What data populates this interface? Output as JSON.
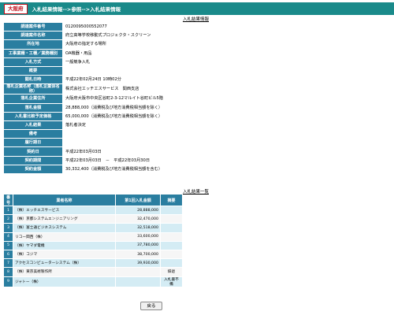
{
  "header": {
    "prefecture": "大阪府",
    "breadcrumb": "入札結果情報-->参照-->入札結果情報"
  },
  "details": {
    "caption": "入札結果情報",
    "rows": [
      {
        "label": "調達案件番号",
        "value": "0120095000552077"
      },
      {
        "label": "調達案件名称",
        "value": "府立高等学校移動式プロジェクタ・スクリーン"
      },
      {
        "label": "所在地",
        "value": "大阪府の指定する場所"
      },
      {
        "label": "工事業種・工種／業務種別",
        "value": "OA機器・用品"
      },
      {
        "label": "入札方式",
        "value": "一般競争入札"
      },
      {
        "label": "概要",
        "value": ""
      },
      {
        "label": "開札日時",
        "value": "平成22年02月24日 10時02分"
      },
      {
        "label": "落札企業名称（落札企業体名称）",
        "value": "株式会社エッチエスサービス　関西支店"
      },
      {
        "label": "落札企業住所",
        "value": "大阪府大阪市中央区谷町2-3-12マルイト谷町ビル5階"
      },
      {
        "label": "落札金額",
        "value": "28,888,000（消費税及び地方消費税相当額を除く）"
      },
      {
        "label": "入札書比較予定価格",
        "value": "65,000,000（消費税及び地方消費税相当額を除く）"
      },
      {
        "label": "入札結果",
        "value": "落札者決定"
      },
      {
        "label": "備考",
        "value": ""
      },
      {
        "label": "履行期日",
        "value": ""
      },
      {
        "label": "契約日",
        "value": "平成22年03月03日"
      },
      {
        "label": "契約期間",
        "value": "平成22年03月03日　－　平成22年03月30日"
      },
      {
        "label": "契約金額",
        "value": "30,332,400（消費税及び地方消費税相当額を含む）"
      }
    ]
  },
  "results": {
    "caption": "入札結果一覧",
    "headers": {
      "no": "番号",
      "name": "業者名称",
      "amount": "第1回入札金額",
      "remark": "摘要"
    },
    "rows": [
      {
        "no": "1",
        "name": "（株）エッチエスサービス",
        "amount": "28,888,000",
        "remark": ""
      },
      {
        "no": "2",
        "name": "（株）京都システムエンジニアリング",
        "amount": "32,470,000",
        "remark": ""
      },
      {
        "no": "3",
        "name": "（株）富士通ビジネスシステム",
        "amount": "32,518,000",
        "remark": ""
      },
      {
        "no": "4",
        "name": "リコー関西（株）",
        "amount": "33,600,000",
        "remark": ""
      },
      {
        "no": "5",
        "name": "（株）ヤマダ電機",
        "amount": "37,780,000",
        "remark": ""
      },
      {
        "no": "6",
        "name": "（株）コジマ",
        "amount": "38,700,000",
        "remark": ""
      },
      {
        "no": "7",
        "name": "アクセスコンピューターシステム（株）",
        "amount": "39,930,000",
        "remark": ""
      },
      {
        "no": "8",
        "name": "（株）東京美術製作所",
        "amount": "",
        "remark": "辞退"
      },
      {
        "no": "9",
        "name": "ジャトー（株）",
        "amount": "",
        "remark": "入札書不備"
      }
    ]
  },
  "back_button": "戻る"
}
